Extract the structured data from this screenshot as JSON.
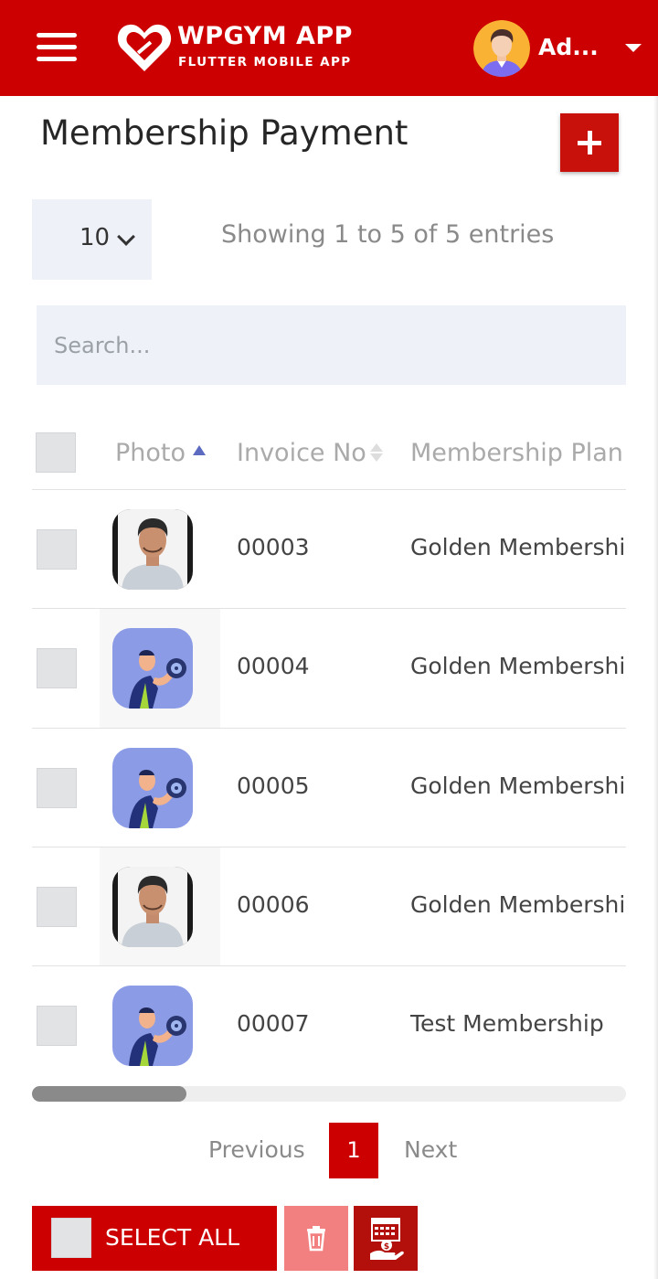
{
  "header": {
    "app_title": "WPGYM APP",
    "app_subtitle": "FLUTTER MOBILE APP",
    "user_name": "Ad...",
    "menu_icon": "hamburger-menu-icon",
    "logo_icon": "heart-dumbbell-logo-icon",
    "caret_icon": "caret-down-icon",
    "brand_color": "#cc0000"
  },
  "page": {
    "title": "Membership Payment",
    "add_icon": "plus-icon"
  },
  "controls": {
    "page_length": "10",
    "entries_info": "Showing 1 to 5 of 5 entries",
    "search_placeholder": "Search..."
  },
  "table": {
    "columns": [
      "Photo",
      "Invoice No",
      "Membership Plan"
    ],
    "rows": [
      {
        "photo": "man-photo",
        "invoice": "00003",
        "plan": "Golden Membership"
      },
      {
        "photo": "dumbbell-avatar",
        "invoice": "00004",
        "plan": "Golden Membership"
      },
      {
        "photo": "dumbbell-avatar",
        "invoice": "00005",
        "plan": "Golden Membership"
      },
      {
        "photo": "man-photo",
        "invoice": "00006",
        "plan": "Golden Membership"
      },
      {
        "photo": "dumbbell-avatar",
        "invoice": "00007",
        "plan": "Test Membership"
      }
    ]
  },
  "pagination": {
    "previous": "Previous",
    "current": "1",
    "next": "Next"
  },
  "actions": {
    "select_all": "SELECT ALL",
    "delete_icon": "trash-icon",
    "payment_icon": "payment-calendar-icon"
  }
}
